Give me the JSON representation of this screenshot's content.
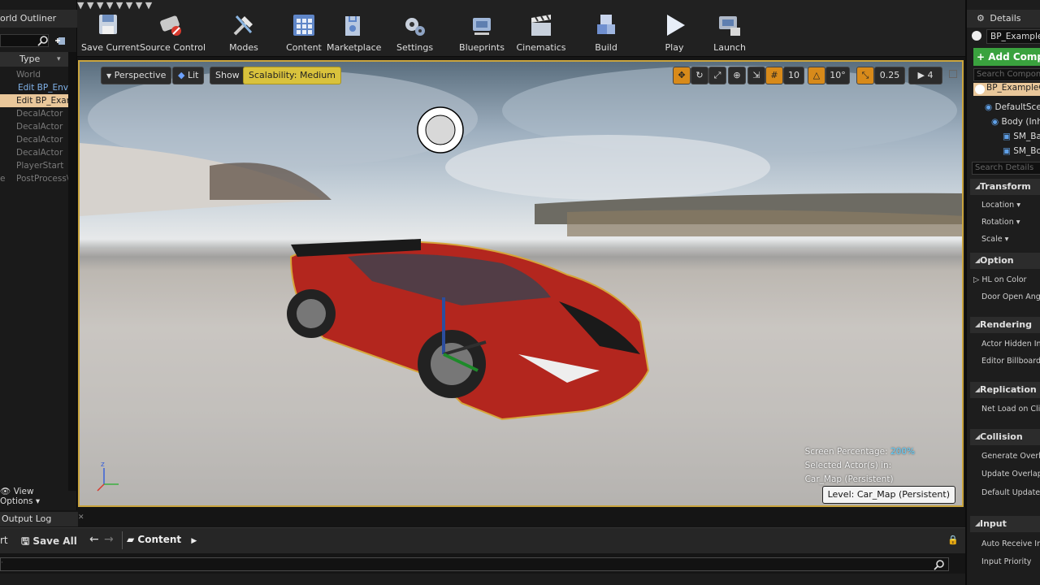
{
  "outliner": {
    "title": "orld Outliner",
    "type_header": "Type",
    "rows": [
      "World",
      "Edit BP_Envi",
      "Edit BP_Exar",
      "DecalActor",
      "DecalActor",
      "DecalActor",
      "DecalActor",
      "PlayerStart",
      "PostProcess\\"
    ],
    "row_edge_label": "e",
    "view_options": "View Options"
  },
  "toolbar": {
    "save_current": "Save Current",
    "source_control": "Source Control",
    "modes": "Modes",
    "content": "Content",
    "marketplace": "Marketplace",
    "settings": "Settings",
    "blueprints": "Blueprints",
    "cinematics": "Cinematics",
    "build": "Build",
    "play": "Play",
    "launch": "Launch"
  },
  "viewport": {
    "perspective": "Perspective",
    "lit": "Lit",
    "show": "Show",
    "scalability": "Scalability: Medium",
    "grid_snap": "10",
    "rot_snap": "10°",
    "scale_snap": "0.25",
    "cam_speed": "4",
    "screen_percentage_label": "Screen Percentage:",
    "screen_percentage_value": "200%",
    "selected_actors": "Selected Actor(s) in:",
    "map_name": "Car_Map (Persistent)",
    "level_label": "Level:",
    "level_value": "Car_Map (Persistent)"
  },
  "bottom": {
    "output_log": "Output Log",
    "rt": "rt",
    "save_all": "Save All",
    "content": "Content"
  },
  "details": {
    "title": "Details",
    "selected": "BP_ExampleC",
    "add_component": "+ Add Compo",
    "search_components": "Search Compone",
    "tree": [
      "BP_ExampleC",
      "DefaultSce",
      "Body (Inh",
      "SM_Bas",
      "SM_Bod"
    ],
    "search_details": "Search Details",
    "sections": {
      "transform": "Transform",
      "location": "Location",
      "rotation": "Rotation",
      "scale": "Scale",
      "option": "Option",
      "hl_on_color": "HL on Color",
      "door_open_angle": "Door Open Angle",
      "rendering": "Rendering",
      "actor_hidden": "Actor Hidden In G",
      "editor_billboard": "Editor Billboard S",
      "replication": "Replication",
      "net_load": "Net Load on Clie",
      "collision": "Collision",
      "generate_overlap": "Generate Overlap",
      "update_overlaps": "Update Overlaps",
      "default_update": "Default Update O",
      "input": "Input",
      "auto_receive": "Auto Receive Inp",
      "input_priority": "Input Priority"
    }
  }
}
